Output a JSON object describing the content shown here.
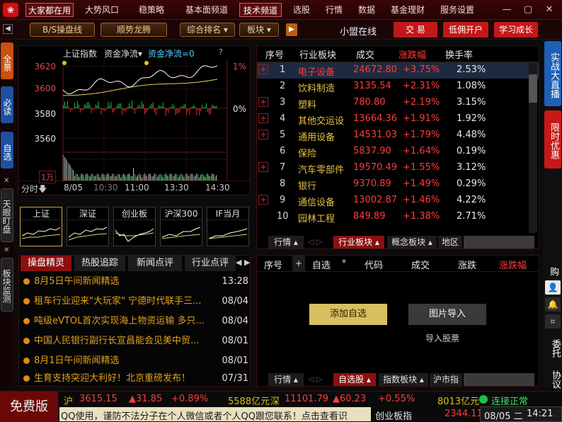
{
  "topbar": {
    "menu": [
      "大家都在用",
      "大势风口",
      "稳策略",
      "基本面频道",
      "技术频道",
      "选股",
      "行情",
      "数据",
      "基金理财",
      "服务设置"
    ]
  },
  "toolbar": {
    "bs_label": "B/S操盘线",
    "trend_label": "顺势龙腾",
    "rank_label": "综合排名",
    "sector_label": "板块",
    "center_title": "小盟在线",
    "trade_label": "交 易",
    "open_label": "低佣开户",
    "learn_label": "学习成长"
  },
  "left_tabs": [
    "全景",
    "必读",
    "自选",
    "天眼盯盘",
    "板块监测"
  ],
  "right_tabs": [
    "实战大直播",
    "限时优惠",
    "购",
    "委托",
    "协议"
  ],
  "chart": {
    "index_name": "上证指数",
    "indicator": "资金净流",
    "indicator_value": "资金净流=0",
    "help": "?",
    "y_labels": [
      "3620",
      "3600",
      "3580",
      "3560"
    ],
    "pct_labels": [
      "1%",
      "0%"
    ],
    "volume_label": "1万",
    "x_labels": [
      "分时",
      "8/05",
      "11:00",
      "13:30",
      "14:30"
    ],
    "x_extra": "10:30",
    "colors": {
      "up": "#e03030",
      "down": "#20c040",
      "price": "#ffffff",
      "avg": "#e8d060"
    }
  },
  "mini_charts": [
    "上证",
    "深证",
    "创业板",
    "沪深300",
    "IF当月"
  ],
  "news": {
    "tabs": [
      "操盘精灵",
      "热股追踪",
      "新闻点评",
      "行业点评"
    ],
    "items": [
      {
        "title": "8月5日午间新闻精选",
        "time": "13:28"
      },
      {
        "title": "租车行业迎来\"大玩家\" 宁德时代联手三...",
        "time": "08/04"
      },
      {
        "title": "吨级eVTOL首次实现海上物资运输 多只...",
        "time": "08/04"
      },
      {
        "title": "中国人民银行副行长宣昌能会见美中贸...",
        "time": "08/01"
      },
      {
        "title": "8月1日午间新闻精选",
        "time": "08/01"
      },
      {
        "title": "生育支持突迎大利好！北京重磅发布！",
        "time": "07/31"
      }
    ]
  },
  "sectors": {
    "headers": [
      "序号",
      "行业板块",
      "成交",
      "涨跌幅",
      "换手率"
    ],
    "rows": [
      {
        "no": "1",
        "name": "电子设备",
        "amount": "24672.80",
        "change": "+3.75%",
        "turnover": "2.53%"
      },
      {
        "no": "2",
        "name": "饮料制造",
        "amount": "3135.54",
        "change": "+2.31%",
        "turnover": "1.08%"
      },
      {
        "no": "3",
        "name": "塑料",
        "amount": "780.80",
        "change": "+2.19%",
        "turnover": "3.15%"
      },
      {
        "no": "4",
        "name": "其他交运设",
        "amount": "13664.36",
        "change": "+1.91%",
        "turnover": "1.92%"
      },
      {
        "no": "5",
        "name": "通用设备",
        "amount": "14531.03",
        "change": "+1.79%",
        "turnover": "4.48%"
      },
      {
        "no": "6",
        "name": "保险",
        "amount": "5837.90",
        "change": "+1.64%",
        "turnover": "0.19%"
      },
      {
        "no": "7",
        "name": "汽车零部件",
        "amount": "19570.49",
        "change": "+1.55%",
        "turnover": "3.12%"
      },
      {
        "no": "8",
        "name": "银行",
        "amount": "9370.89",
        "change": "+1.49%",
        "turnover": "0.29%"
      },
      {
        "no": "9",
        "name": "通信设备",
        "amount": "13002.87",
        "change": "+1.46%",
        "turnover": "4.22%"
      },
      {
        "no": "10",
        "name": "园林工程",
        "amount": "849.89",
        "change": "+1.38%",
        "turnover": "2.71%"
      }
    ],
    "bottom_tabs": [
      "行情",
      "行业板块",
      "概念板块",
      "地区"
    ]
  },
  "watchlist": {
    "headers": [
      "序号",
      "自选",
      "代码",
      "成交",
      "涨跌",
      "涨跌幅"
    ],
    "add_label": "添加自选",
    "import_label": "图片导入",
    "import_stock": "导入股票",
    "bottom_tabs": [
      "行情",
      "自选股",
      "指数板块",
      "沪市指数"
    ]
  },
  "status": {
    "free_label": "免费版",
    "sh_label": "沪",
    "sh_value": "3615.15",
    "sh_change": "▲31.85",
    "sh_pct": "+0.89%",
    "sh_amount": "5588亿元",
    "sz_label": "深",
    "sz_value": "11101.79",
    "sz_change": "▲60.23",
    "sz_pct": "+0.55%",
    "sz_amount": "8013亿元",
    "conn": "连接正常",
    "notice": "QQ使用，谨防不法分子在个人微信或者个人QQ跟您联系！点击查看识",
    "board": "创业板指",
    "board_value": "2344.11",
    "date": "08/05 二",
    "time": "14:21"
  }
}
